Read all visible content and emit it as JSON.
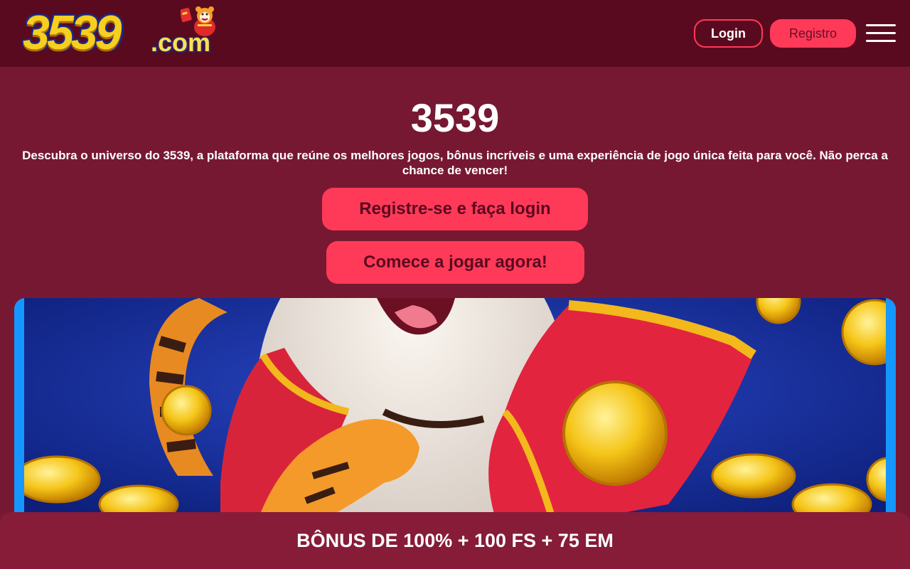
{
  "header": {
    "logo": {
      "main": "3539",
      "suffix": ".com"
    },
    "login_label": "Login",
    "register_label": "Registro",
    "menu_icon": "hamburger-menu-icon"
  },
  "hero": {
    "title": "3539",
    "description": "Descubra o universo do 3539, a plataforma que reúne os melhores jogos, bônus incríveis e uma experiência de jogo única feita para você. Não perca a chance de vencer!",
    "cta_primary": "Registre-se e faça login",
    "cta_secondary": "Comece a jogar agora!"
  },
  "banner": {
    "image": "fortune-tiger-mascot-with-gold-coins"
  },
  "bonus_bar": {
    "text": "BÔNUS DE 100% + 100 FS + 75 EM"
  },
  "colors": {
    "background": "#771832",
    "header": "#5a0a1e",
    "accent": "#ff3a59",
    "bonus_bar": "#861c38",
    "banner_border": "#1597ff"
  }
}
